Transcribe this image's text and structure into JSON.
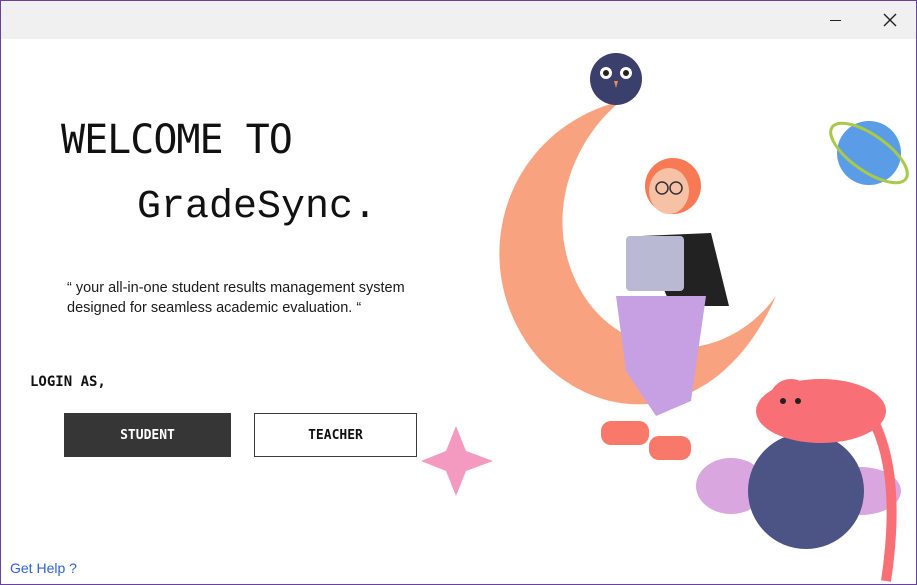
{
  "window": {
    "minimize_label": "–",
    "close_label": "✕"
  },
  "hero": {
    "welcome": "WELCOME TO",
    "brand": "GradeSync.",
    "tagline": "“ your all-in-one student results management system designed for seamless academic evaluation. “"
  },
  "login": {
    "label": "LOGIN AS,",
    "student_label": "STUDENT",
    "teacher_label": "TEACHER"
  },
  "footer": {
    "help_label": "Get Help ?"
  },
  "illustration": {
    "description_icon": "moon-girl-laptop-illustration"
  },
  "colors": {
    "titlebar": "#f0f0f0",
    "student_button": "#363636",
    "link": "#2d5fd6",
    "moon": "#f7a07c"
  }
}
